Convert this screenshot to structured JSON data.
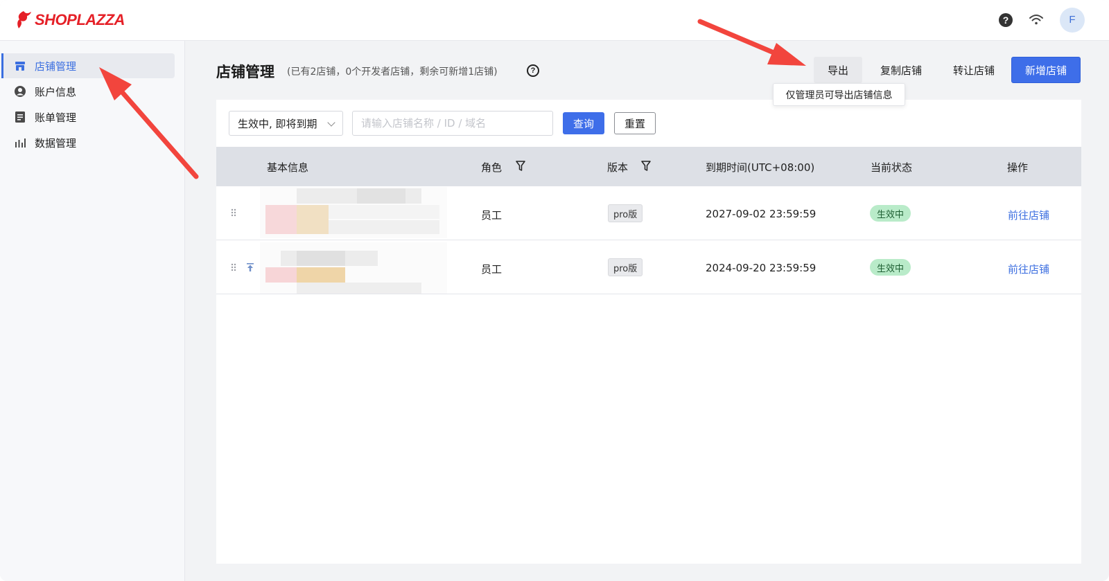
{
  "header": {
    "logo_text": "SHOPLAZZA",
    "help_icon": "question-circle-icon",
    "network_icon": "wifi-icon",
    "avatar_letter": "F"
  },
  "sidebar": {
    "items": [
      {
        "label": "店铺管理",
        "icon": "store-icon",
        "active": true
      },
      {
        "label": "账户信息",
        "icon": "user-icon",
        "active": false
      },
      {
        "label": "账单管理",
        "icon": "bill-icon",
        "active": false
      },
      {
        "label": "数据管理",
        "icon": "bar-chart-icon",
        "active": false
      }
    ]
  },
  "page": {
    "title": "店铺管理",
    "subtitle": "(已有2店铺，0个开发者店铺，剩余可新增1店铺)"
  },
  "actions": {
    "export_label": "导出",
    "copy_label": "复制店铺",
    "transfer_label": "转让店铺",
    "new_label": "新增店铺",
    "export_tooltip": "仅管理员可导出店铺信息"
  },
  "filters": {
    "status_value": "生效中, 即将到期",
    "search_placeholder": "请输入店铺名称 / ID / 域名",
    "query_label": "查询",
    "reset_label": "重置"
  },
  "table": {
    "columns": [
      "基本信息",
      "角色",
      "版本",
      "到期时间(UTC+08:00)",
      "当前状态",
      "操作"
    ],
    "rows": [
      {
        "role": "员工",
        "version": "pro版",
        "expires": "2027-09-02 23:59:59",
        "status": "生效中",
        "action": "前往店铺",
        "pinned": false
      },
      {
        "role": "员工",
        "version": "pro版",
        "expires": "2024-09-20 23:59:59",
        "status": "生效中",
        "action": "前往店铺",
        "pinned": true
      }
    ]
  },
  "colors": {
    "primary": "#3e6ee9",
    "brand_red": "#e52027",
    "status_green_bg": "#b9ebc9",
    "annotation_arrow": "#f2453d"
  }
}
